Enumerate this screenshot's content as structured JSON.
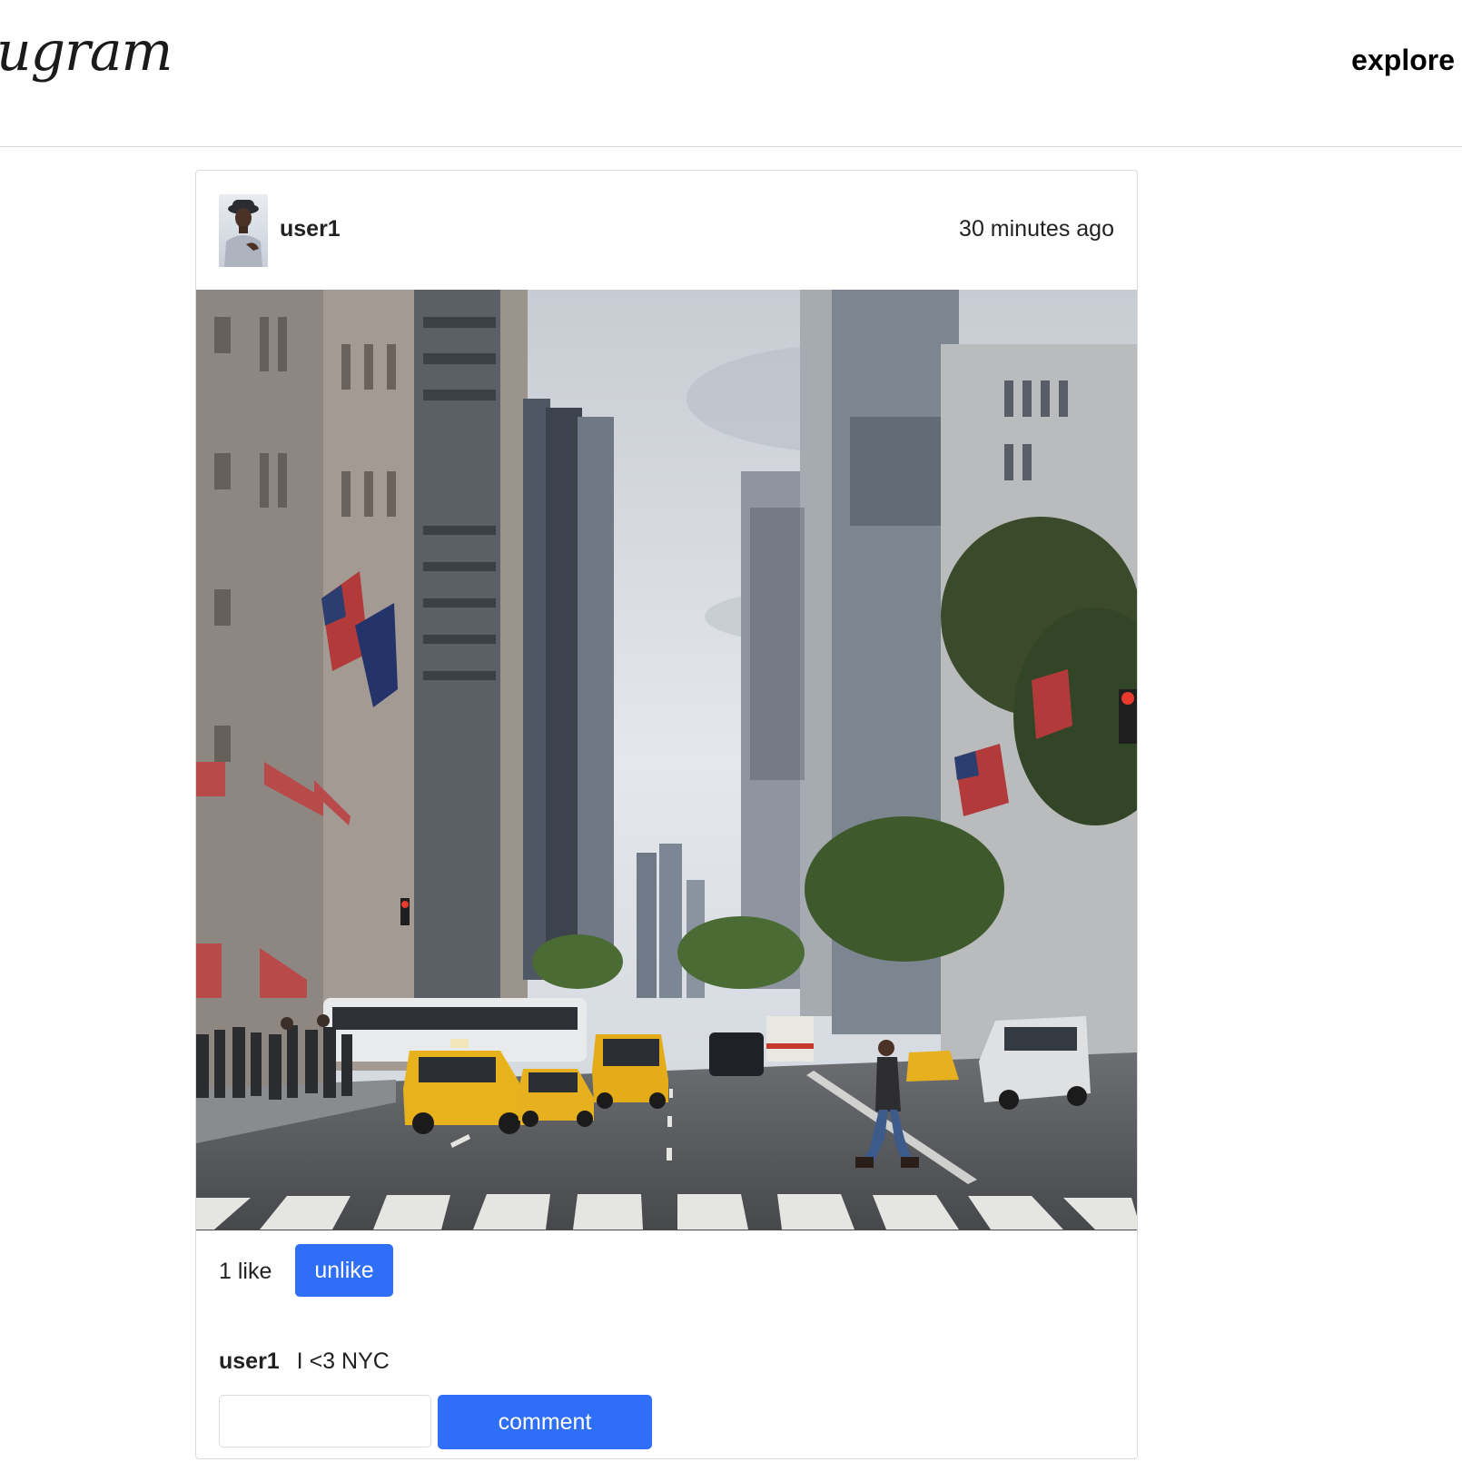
{
  "header": {
    "logo_text": "ugram",
    "nav": {
      "explore_label": "explore"
    }
  },
  "post": {
    "author": "user1",
    "timestamp": "30 minutes ago",
    "image_description": "",
    "likes": {
      "count_text": "1 like",
      "unlike_label": "unlike"
    },
    "caption": {
      "user": "user1",
      "text": "I <3 NYC"
    },
    "comment_form": {
      "input_value": "",
      "input_placeholder": "",
      "submit_label": "comment"
    }
  },
  "colors": {
    "button_blue": "#2f6ef6",
    "border_gray": "#dbdbdb",
    "text_dark": "#222222",
    "taxi_yellow": "#e8b21c"
  }
}
